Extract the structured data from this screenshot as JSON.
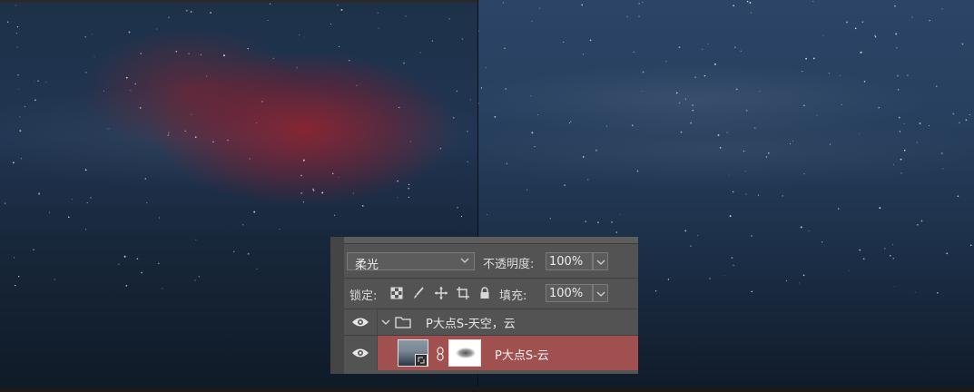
{
  "layers_panel": {
    "blend_mode": "柔光",
    "opacity_label": "不透明度:",
    "opacity_value": "100%",
    "lock_label": "锁定:",
    "fill_label": "填充:",
    "fill_value": "100%",
    "group": {
      "name": "P大点S-天空，云",
      "visible": true,
      "expanded": true
    },
    "layers": [
      {
        "name": "P大点S-云",
        "visible": true,
        "selected": true,
        "has_mask": true,
        "smart_object": true
      }
    ]
  },
  "colors": {
    "panel_bg": "#535353",
    "selected_layer": "#a0504f",
    "red_glow": "#a01e28"
  }
}
